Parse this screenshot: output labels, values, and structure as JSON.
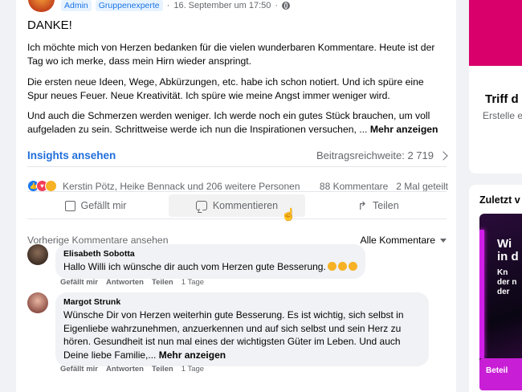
{
  "post": {
    "badges": [
      "Admin",
      "Gruppenexperte"
    ],
    "timestamp": "16. September um 17:50",
    "title": "DANKE!",
    "paragraphs": [
      "Ich möchte mich von Herzen bedanken für die vielen wunderbaren Kommentare. Heute ist der Tag wo ich merke, dass mein Hirn wieder anspringt.",
      "Die ersten neue Ideen, Wege, Abkürzungen, etc. habe ich schon notiert. Und ich spüre eine Spur neues Feuer. Neue Kreativität. Ich spüre wie meine Angst immer weniger wird.",
      "Und auch die Schmerzen werden weniger. Ich werde noch ein gutes Stück brauchen, um voll aufgeladen zu sein. Schrittweise werde ich nun die Inspirationen versuchen, ..."
    ],
    "more_label": "Mehr anzeigen",
    "insights_label": "Insights ansehen",
    "reach_label": "Beitragsreichweite: 2 719",
    "reactions_text": "Kerstin Pötz, Heike Bennack und 206 weitere Personen",
    "comments_count": "88 Kommentare",
    "shares_count": "2 Mal geteilt",
    "actions": {
      "like": "Gefällt mir",
      "comment": "Kommentieren",
      "share": "Teilen"
    }
  },
  "comments": {
    "previous_label": "Vorherige Kommentare ansehen",
    "sort_label": "Alle Kommentare",
    "items": [
      {
        "name": "Elisabeth Sobotta",
        "text": "Hallo Willi ich wünsche dir auch vom Herzen gute Besserung.",
        "like": "Gefällt mir",
        "reply": "Antworten",
        "share": "Teilen",
        "time": "1 Tage"
      },
      {
        "name": "Margot Strunk",
        "text": "Wünsche Dir von Herzen weiterhin gute Besserung. Es ist wichtig, sich selbst in Eigenliebe wahrzunehmen, anzuerkennen und auf sich selbst und sein Herz zu hören. Gesundheit ist nun mal eines der wichtigsten Güter im Leben. Und auch Deine liebe Familie,...",
        "more": "Mehr anzeigen",
        "like": "Gefällt mir",
        "reply": "Antworten",
        "share": "Teilen",
        "time": "1 Tage"
      }
    ]
  },
  "sidebar": {
    "card1_title": "Triff d",
    "card1_sub": "Erstelle e",
    "card2_title": "Zuletzt v",
    "promo_line1": "Wi",
    "promo_line1b": "in d",
    "promo_line2": "Kn",
    "promo_line2b": "der n",
    "promo_line2c": "der",
    "promo2_text": "Beteil"
  },
  "colors": {
    "accent": "#216fdb",
    "muted": "#65676b",
    "background": "#f0f2f5"
  }
}
